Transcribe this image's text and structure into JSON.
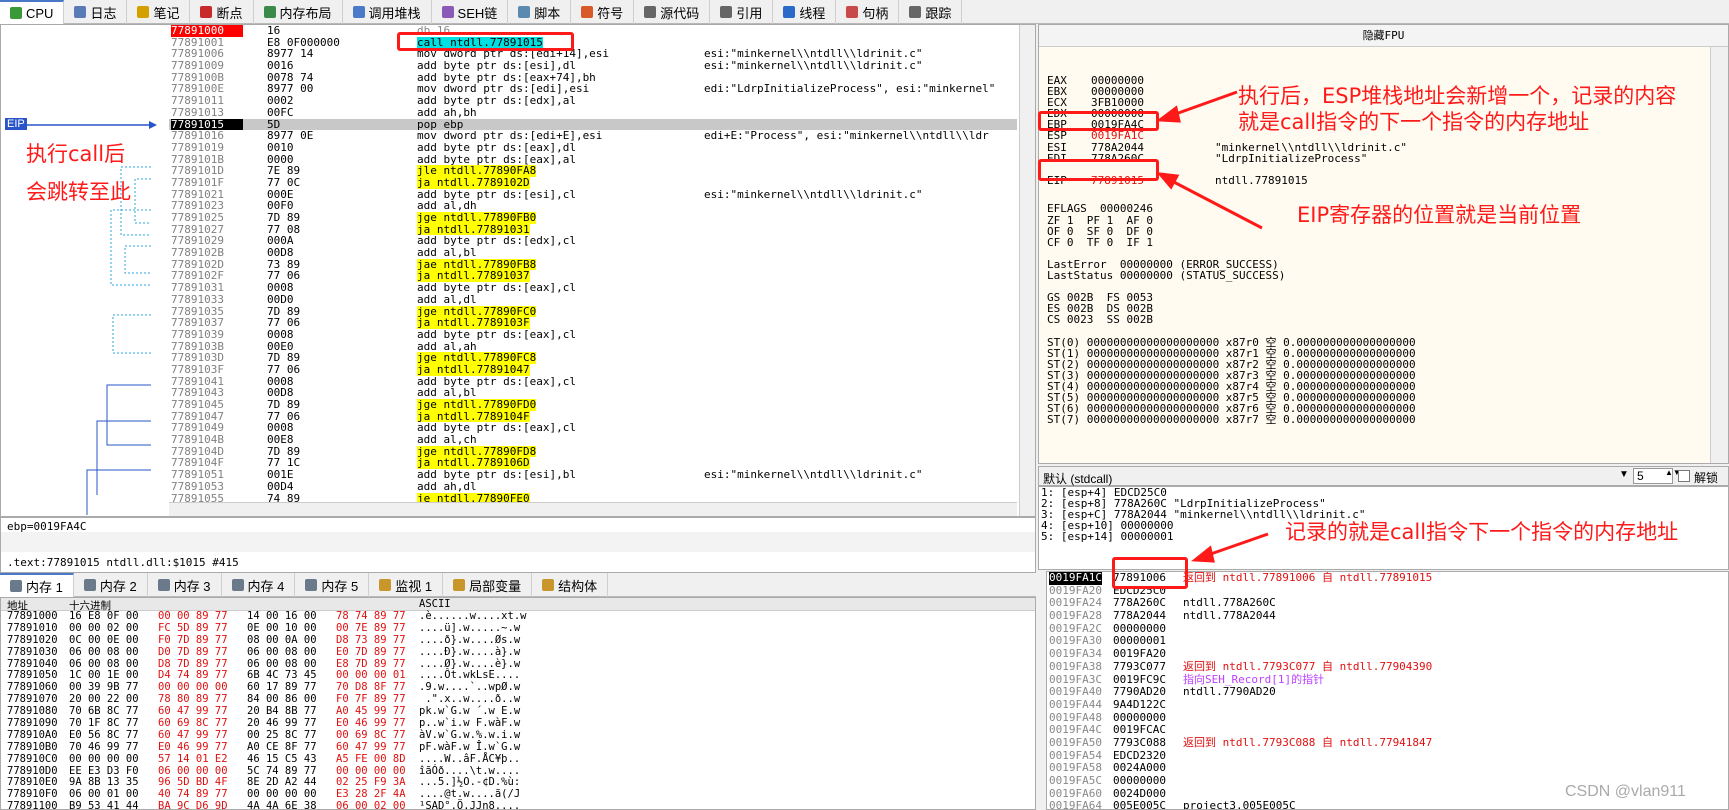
{
  "tabs": [
    {
      "label": "CPU",
      "icon": "cpu-icon",
      "color": "#3a9a3a",
      "active": true
    },
    {
      "label": "日志",
      "icon": "log-icon",
      "color": "#5a7ab8"
    },
    {
      "label": "笔记",
      "icon": "notes-icon",
      "color": "#d4a000"
    },
    {
      "label": "断点",
      "icon": "breakpoint-icon",
      "color": "#c82a2a"
    },
    {
      "label": "内存布局",
      "icon": "memory-map-icon",
      "color": "#3a8a4a"
    },
    {
      "label": "调用堆栈",
      "icon": "call-stack-icon",
      "color": "#4a7ac8"
    },
    {
      "label": "SEH链",
      "icon": "seh-icon",
      "color": "#8a5ab8"
    },
    {
      "label": "脚本",
      "icon": "script-icon",
      "color": "#5a8ab0"
    },
    {
      "label": "符号",
      "icon": "symbol-icon",
      "color": "#d85a2a"
    },
    {
      "label": "源代码",
      "icon": "source-icon",
      "color": "#666666"
    },
    {
      "label": "引用",
      "icon": "references-icon",
      "color": "#666666"
    },
    {
      "label": "线程",
      "icon": "threads-icon",
      "color": "#2a6ac8"
    },
    {
      "label": "句柄",
      "icon": "handles-icon",
      "color": "#c84a4a"
    },
    {
      "label": "跟踪",
      "icon": "trace-icon",
      "color": "#666666"
    }
  ],
  "disasm": [
    {
      "addr": "77891000",
      "bytes": "16",
      "ins": "db 16",
      "com": ""
    },
    {
      "addr": "77891001",
      "bytes": "E8 0F000000",
      "ins": "call ntdll.77891015",
      "com": ""
    },
    {
      "addr": "77891006",
      "bytes": "8977 14",
      "ins": "mov dword ptr ds:[edi+14],esi",
      "com": "esi:\"minkernel\\\\ntdll\\\\ldrinit.c\""
    },
    {
      "addr": "77891009",
      "bytes": "0016",
      "ins": "add byte ptr ds:[esi],dl",
      "com": "esi:\"minkernel\\\\ntdll\\\\ldrinit.c\""
    },
    {
      "addr": "7789100B",
      "bytes": "0078 74",
      "ins": "add byte ptr ds:[eax+74],bh",
      "com": ""
    },
    {
      "addr": "7789100E",
      "bytes": "8977 00",
      "ins": "mov dword ptr ds:[edi],esi",
      "com": "edi:\"LdrpInitializeProcess\", esi:\"minkernel\""
    },
    {
      "addr": "77891011",
      "bytes": "0002",
      "ins": "add byte ptr ds:[edx],al",
      "com": ""
    },
    {
      "addr": "77891013",
      "bytes": "00FC",
      "ins": "add ah,bh",
      "com": ""
    },
    {
      "addr": "77891015",
      "bytes": "5D",
      "ins": "pop ebp",
      "com": ""
    },
    {
      "addr": "77891016",
      "bytes": "8977 0E",
      "ins": "mov dword ptr ds:[edi+E],esi",
      "com": "edi+E:\"Process\", esi:\"minkernel\\\\ntdll\\\\ldr"
    },
    {
      "addr": "77891019",
      "bytes": "0010",
      "ins": "add byte ptr ds:[eax],dl",
      "com": ""
    },
    {
      "addr": "7789101B",
      "bytes": "0000",
      "ins": "add byte ptr ds:[eax],al",
      "com": ""
    },
    {
      "addr": "7789101D",
      "bytes": "7E 89",
      "ins": "jle ntdll.77890FA8",
      "com": ""
    },
    {
      "addr": "7789101F",
      "bytes": "77 0C",
      "ins": "ja ntdll.7789102D",
      "com": ""
    },
    {
      "addr": "77891021",
      "bytes": "000E",
      "ins": "add byte ptr ds:[esi],cl",
      "com": "esi:\"minkernel\\\\ntdll\\\\ldrinit.c\""
    },
    {
      "addr": "77891023",
      "bytes": "00F0",
      "ins": "add al,dh",
      "com": ""
    },
    {
      "addr": "77891025",
      "bytes": "7D 89",
      "ins": "jge ntdll.77890FB0",
      "com": ""
    },
    {
      "addr": "77891027",
      "bytes": "77 08",
      "ins": "ja ntdll.77891031",
      "com": ""
    },
    {
      "addr": "77891029",
      "bytes": "000A",
      "ins": "add byte ptr ds:[edx],cl",
      "com": ""
    },
    {
      "addr": "7789102B",
      "bytes": "00D8",
      "ins": "add al,bl",
      "com": ""
    },
    {
      "addr": "7789102D",
      "bytes": "73 89",
      "ins": "jae ntdll.77890FB8",
      "com": ""
    },
    {
      "addr": "7789102F",
      "bytes": "77 06",
      "ins": "ja ntdll.77891037",
      "com": ""
    },
    {
      "addr": "77891031",
      "bytes": "0008",
      "ins": "add byte ptr ds:[eax],cl",
      "com": ""
    },
    {
      "addr": "77891033",
      "bytes": "00D0",
      "ins": "add al,dl",
      "com": ""
    },
    {
      "addr": "77891035",
      "bytes": "7D 89",
      "ins": "jge ntdll.77890FC0",
      "com": ""
    },
    {
      "addr": "77891037",
      "bytes": "77 06",
      "ins": "ja ntdll.7789103F",
      "com": ""
    },
    {
      "addr": "77891039",
      "bytes": "0008",
      "ins": "add byte ptr ds:[eax],cl",
      "com": ""
    },
    {
      "addr": "7789103B",
      "bytes": "00E0",
      "ins": "add al,ah",
      "com": ""
    },
    {
      "addr": "7789103D",
      "bytes": "7D 89",
      "ins": "jge ntdll.77890FC8",
      "com": ""
    },
    {
      "addr": "7789103F",
      "bytes": "77 06",
      "ins": "ja ntdll.77891047",
      "com": ""
    },
    {
      "addr": "77891041",
      "bytes": "0008",
      "ins": "add byte ptr ds:[eax],cl",
      "com": ""
    },
    {
      "addr": "77891043",
      "bytes": "00D8",
      "ins": "add al,bl",
      "com": ""
    },
    {
      "addr": "77891045",
      "bytes": "7D 89",
      "ins": "jge ntdll.77890FD0",
      "com": ""
    },
    {
      "addr": "77891047",
      "bytes": "77 06",
      "ins": "ja ntdll.7789104F",
      "com": ""
    },
    {
      "addr": "77891049",
      "bytes": "0008",
      "ins": "add byte ptr ds:[eax],cl",
      "com": ""
    },
    {
      "addr": "7789104B",
      "bytes": "00E8",
      "ins": "add al,ch",
      "com": ""
    },
    {
      "addr": "7789104D",
      "bytes": "7D 89",
      "ins": "jge ntdll.77890FD8",
      "com": ""
    },
    {
      "addr": "7789104F",
      "bytes": "77 1C",
      "ins": "ja ntdll.7789106D",
      "com": ""
    },
    {
      "addr": "77891051",
      "bytes": "001E",
      "ins": "add byte ptr ds:[esi],bl",
      "com": "esi:\"minkernel\\\\ntdll\\\\ldrinit.c\""
    },
    {
      "addr": "77891053",
      "bytes": "00D4",
      "ins": "add ah,dl",
      "com": ""
    },
    {
      "addr": "77891055",
      "bytes": "74 89",
      "ins": "je ntdll.77890FE0",
      "com": ""
    }
  ],
  "gutter": {
    "eip_label": "EIP"
  },
  "cpu_info": {
    "line1": "ebp=0019FA4C",
    "line2": ".text:77891015 ntdll.dll:$1015 #415"
  },
  "regs": {
    "title": "隐藏FPU",
    "lines": [
      {
        "name": "EAX",
        "val": "00000000",
        "com": ""
      },
      {
        "name": "EBX",
        "val": "00000000",
        "com": ""
      },
      {
        "name": "ECX",
        "val": "3FB10000",
        "com": ""
      },
      {
        "name": "EDX",
        "val": "00000000",
        "com": ""
      },
      {
        "name": "EBP",
        "val": "0019FA4C",
        "com": ""
      },
      {
        "name": "ESP",
        "val": "0019FA1C",
        "com": ""
      },
      {
        "name": "ESI",
        "val": "778A2044",
        "com": "\"minkernel\\\\ntdll\\\\ldrinit.c\""
      },
      {
        "name": "EDI",
        "val": "778A260C",
        "com": "\"LdrpInitializeProcess\""
      },
      {
        "name": "EIP",
        "val": "77891015",
        "com": "ntdll.77891015"
      }
    ],
    "eflags": "EFLAGS  00000246",
    "flags1": "ZF 1  PF 1  AF 0",
    "flags2": "OF 0  SF 0  DF 0",
    "flags3": "CF 0  TF 0  IF 1",
    "lasterror": "LastError  00000000 (ERROR_SUCCESS)",
    "laststatus": "LastStatus 00000000 (STATUS_SUCCESS)",
    "seg1": "GS 002B  FS 0053",
    "seg2": "ES 002B  DS 002B",
    "seg3": "CS 0023  SS 002B",
    "st": [
      "ST(0) 00000000000000000000 x87r0 空 0.000000000000000000",
      "ST(1) 00000000000000000000 x87r1 空 0.000000000000000000",
      "ST(2) 00000000000000000000 x87r2 空 0.000000000000000000",
      "ST(3) 00000000000000000000 x87r3 空 0.000000000000000000",
      "ST(4) 00000000000000000000 x87r4 空 0.000000000000000000",
      "ST(5) 00000000000000000000 x87r5 空 0.000000000000000000",
      "ST(6) 00000000000000000000 x87r6 空 0.000000000000000000",
      "ST(7) 00000000000000000000 x87r7 空 0.000000000000000000"
    ]
  },
  "stack_header": {
    "convention": "默认 (stdcall)",
    "count": "5",
    "unlock": "解锁"
  },
  "stack_args": [
    "1: [esp+4] EDCD25C0",
    "2: [esp+8] 778A260C \"LdrpInitializeProcess\"",
    "3: [esp+C] 778A2044 \"minkernel\\\\ntdll\\\\ldrinit.c\"",
    "4: [esp+10] 00000000",
    "5: [esp+14] 00000001"
  ],
  "mem_tabs": [
    {
      "label": "内存 1",
      "icon": "memory-icon"
    },
    {
      "label": "内存 2",
      "icon": "memory-icon"
    },
    {
      "label": "内存 3",
      "icon": "memory-icon"
    },
    {
      "label": "内存 4",
      "icon": "memory-icon"
    },
    {
      "label": "内存 5",
      "icon": "memory-icon"
    },
    {
      "label": "监视 1",
      "icon": "watch-icon"
    },
    {
      "label": "局部变量",
      "icon": "locals-icon"
    },
    {
      "label": "结构体",
      "icon": "struct-icon"
    }
  ],
  "dump_header": {
    "addr": "地址",
    "hex": "十六进制",
    "ascii": "ASCII"
  },
  "dump": [
    {
      "addr": "77891000",
      "h1": "16 E8 0F 00",
      "h2": "00 00 89 77",
      "h3": "14 00 16 00",
      "h4": "78 74 89 77",
      "asc": ".è......w....xt.w"
    },
    {
      "addr": "77891010",
      "h1": "00 00 02 00",
      "h2": "FC 5D 89 77",
      "h3": "0E 00 10 00",
      "h4": "00 7E 89 77",
      "asc": "....ü].w.....~.w"
    },
    {
      "addr": "77891020",
      "h1": "0C 00 0E 00",
      "h2": "F0 7D 89 77",
      "h3": "08 00 0A 00",
      "h4": "D8 73 89 77",
      "asc": "....ð}.w....Øs.w"
    },
    {
      "addr": "77891030",
      "h1": "06 00 08 00",
      "h2": "D0 7D 89 77",
      "h3": "06 00 08 00",
      "h4": "E0 7D 89 77",
      "asc": "....Ð}.w....à}.w"
    },
    {
      "addr": "77891040",
      "h1": "06 00 08 00",
      "h2": "D8 7D 89 77",
      "h3": "06 00 08 00",
      "h4": "E8 7D 89 77",
      "asc": "....Ø}.w....è}.w"
    },
    {
      "addr": "77891050",
      "h1": "1C 00 1E 00",
      "h2": "D4 74 89 77",
      "h3": "6B 4C 73 45",
      "h4": "00 00 00 01",
      "asc": "....Ôt.wkLsE...."
    },
    {
      "addr": "77891060",
      "h1": "00 39 9B 77",
      "h2": "00 00 00 00",
      "h3": "60 17 89 77",
      "h4": "70 D8 8F 77",
      "asc": ".9.w....`..wpØ.w"
    },
    {
      "addr": "77891070",
      "h1": "20 00 22 00",
      "h2": "78 80 89 77",
      "h3": "84 00 86 00",
      "h4": "F0 7F 89 77",
      "asc": " .\".x..w....ð..w"
    },
    {
      "addr": "77891080",
      "h1": "70 6B 8C 77",
      "h2": "60 47 99 77",
      "h3": "20 B4 8B 77",
      "h4": "A0 45 99 77",
      "asc": "pk.w`G.w ´.w E.w"
    },
    {
      "addr": "77891090",
      "h1": "70 1F 8C 77",
      "h2": "60 69 8C 77",
      "h3": "20 46 99 77",
      "h4": "E0 46 99 77",
      "asc": "p..w`i.w F.wàF.w"
    },
    {
      "addr": "778910A0",
      "h1": "E0 56 8C 77",
      "h2": "60 47 99 77",
      "h3": "00 25 8C 77",
      "h4": "00 69 8C 77",
      "asc": "àV.w`G.w.%.w.i.w"
    },
    {
      "addr": "778910B0",
      "h1": "70 46 99 77",
      "h2": "E0 46 99 77",
      "h3": "A0 CE 8F 77",
      "h4": "60 47 99 77",
      "asc": "pF.wàF.w Î.w`G.w"
    },
    {
      "addr": "778910C0",
      "h1": "00 00 00 00",
      "h2": "57 14 01 E2",
      "h3": "46 15 C5 43",
      "h4": "A5 FE 00 8D",
      "asc": "....W..âF.ÅC¥þ.."
    },
    {
      "addr": "778910D0",
      "h1": "EE E3 D3 F0",
      "h2": "06 00 00 00",
      "h3": "5C 74 89 77",
      "h4": "00 00 00 00",
      "asc": "îãÓð....\\t.w...."
    },
    {
      "addr": "778910E0",
      "h1": "9A 8B 13 35",
      "h2": "96 5D BD 4F",
      "h3": "8E 2D A2 44",
      "h4": "02 25 F9 3A",
      "asc": "...5.]½O.-¢D.%ù:"
    },
    {
      "addr": "778910F0",
      "h1": "06 00 01 00",
      "h2": "40 74 89 77",
      "h3": "00 00 00 00",
      "h4": "E3 28 2F 4A",
      "asc": "....@t.w....ã(/J"
    },
    {
      "addr": "77891100",
      "h1": "B9 53 41 44",
      "h2": "BA 9C D6 9D",
      "h3": "4A 4A 6E 38",
      "h4": "06 00 02 00",
      "asc": "¹SAD°.Ö.JJn8...."
    }
  ],
  "stack": [
    {
      "addr": "0019FA1C",
      "val": "77891006",
      "com": "返回到 ntdll.77891006 自 ntdll.77891015",
      "type": "ret",
      "sel": true
    },
    {
      "addr": "0019FA20",
      "val": "EDCD25C0",
      "com": "",
      "type": ""
    },
    {
      "addr": "0019FA24",
      "val": "778A260C",
      "com": "ntdll.778A260C",
      "type": ""
    },
    {
      "addr": "0019FA28",
      "val": "778A2044",
      "com": "ntdll.778A2044",
      "type": ""
    },
    {
      "addr": "0019FA2C",
      "val": "00000000",
      "com": "",
      "type": ""
    },
    {
      "addr": "0019FA30",
      "val": "00000001",
      "com": "",
      "type": ""
    },
    {
      "addr": "0019FA34",
      "val": "0019FA20",
      "com": "",
      "type": ""
    },
    {
      "addr": "0019FA38",
      "val": "7793C077",
      "com": "返回到 ntdll.7793C077 自 ntdll.77904390",
      "type": "ret"
    },
    {
      "addr": "0019FA3C",
      "val": "0019FC9C",
      "com": "指向SEH_Record[1]的指针",
      "type": "seh"
    },
    {
      "addr": "0019FA40",
      "val": "7790AD20",
      "com": "ntdll.7790AD20",
      "type": ""
    },
    {
      "addr": "0019FA44",
      "val": "9A4D122C",
      "com": "",
      "type": ""
    },
    {
      "addr": "0019FA48",
      "val": "00000000",
      "com": "",
      "type": ""
    },
    {
      "addr": "0019FA4C",
      "val": "0019FCAC",
      "com": "",
      "type": ""
    },
    {
      "addr": "0019FA50",
      "val": "7793C088",
      "com": "返回到 ntdll.7793C088 自 ntdll.77941847",
      "type": "ret"
    },
    {
      "addr": "0019FA54",
      "val": "EDCD2320",
      "com": "",
      "type": ""
    },
    {
      "addr": "0019FA58",
      "val": "0024A000",
      "com": "",
      "type": ""
    },
    {
      "addr": "0019FA5C",
      "val": "00000000",
      "com": "",
      "type": ""
    },
    {
      "addr": "0019FA60",
      "val": "0024D000",
      "com": "",
      "type": ""
    },
    {
      "addr": "0019FA64",
      "val": "005E005C",
      "com": "project3.005E005C",
      "type": ""
    }
  ],
  "annotations": {
    "call_note_1": "执行call后",
    "call_note_2": "会跳转至此",
    "esp_note_1": "执行后，ESP堆栈地址会新增一个，记录的内容",
    "esp_note_2": "就是call指令的下一个指令的内存地址",
    "eip_note": "EIP寄存器的位置就是当前位置",
    "stack_note": "记录的就是call指令下一个指令的内存地址"
  },
  "watermark": "CSDN @vlan911"
}
